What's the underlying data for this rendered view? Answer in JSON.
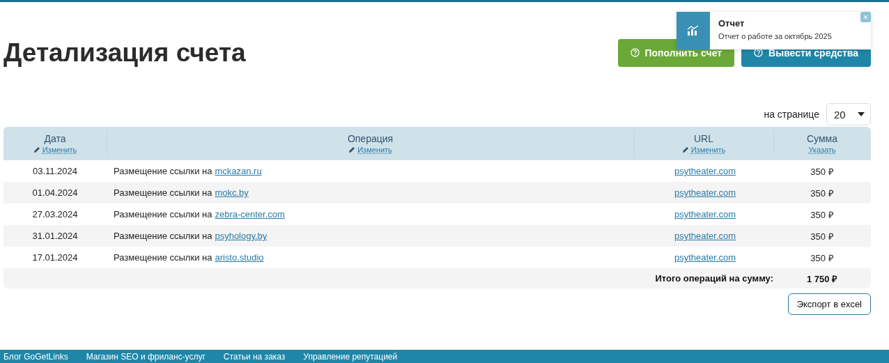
{
  "page_title": "Детализация счета",
  "actions": [
    {
      "label": "Пополнить счет",
      "kind": "deposit"
    },
    {
      "label": "Вывести средства",
      "kind": "withdraw"
    }
  ],
  "notification": {
    "title": "Отчет",
    "message": "Отчет о работе за октябрь 2025",
    "close": "×"
  },
  "per_page": {
    "label": "на странице",
    "value": "20"
  },
  "table": {
    "columns": [
      {
        "title": "Дата",
        "action": "Изменить",
        "edit_icon": true
      },
      {
        "title": "Операция",
        "action": "Изменить",
        "edit_icon": true
      },
      {
        "title": "URL",
        "action": "Изменить",
        "edit_icon": true
      },
      {
        "title": "Сумма",
        "action": "Указать",
        "edit_icon": false
      }
    ],
    "rows": [
      {
        "date": "03.11.2024",
        "operation": "Размещение ссылки на",
        "site": "mckazan.ru",
        "url": "psytheater.com",
        "amount": "350 ₽"
      },
      {
        "date": "01.04.2024",
        "operation": "Размещение ссылки на",
        "site": "mokc.by",
        "url": "psytheater.com",
        "amount": "350 ₽"
      },
      {
        "date": "27.03.2024",
        "operation": "Размещение ссылки на",
        "site": "zebra-center.com",
        "url": "psytheater.com",
        "amount": "350 ₽"
      },
      {
        "date": "31.01.2024",
        "operation": "Размещение ссылки на",
        "site": "psyhology.by",
        "url": "psytheater.com",
        "amount": "350 ₽"
      },
      {
        "date": "17.01.2024",
        "operation": "Размещение ссылки на",
        "site": "aristo.studio",
        "url": "psytheater.com",
        "amount": "350 ₽"
      }
    ],
    "total": {
      "label": "Итого операций на сумму:",
      "value": "1 750 ₽"
    }
  },
  "export_button": "Экспорт в excel",
  "footer_links": [
    "Блог GoGetLinks",
    "Магазин SEO и фриланс-услуг",
    "Статьи на заказ",
    "Управление репутацией"
  ]
}
